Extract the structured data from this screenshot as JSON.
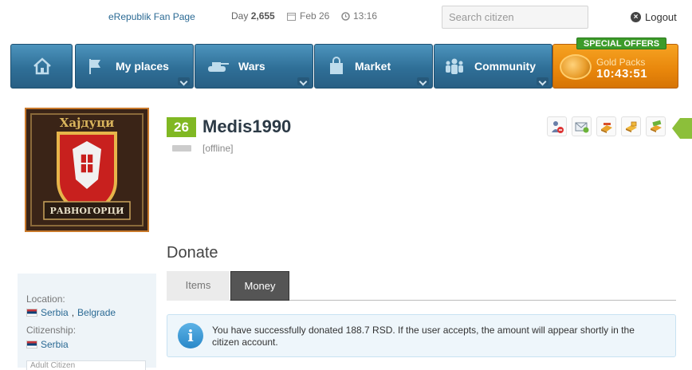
{
  "topbar": {
    "fan_page": "eRepublik Fan Page",
    "day_prefix": "Day",
    "day_number": "2,655",
    "date": "Feb 26",
    "time": "13:16",
    "search_placeholder": "Search citizen",
    "logout": "Logout"
  },
  "nav": {
    "items": [
      {
        "label": "",
        "icon": "home-icon"
      },
      {
        "label": "My places",
        "icon": "flag-icon"
      },
      {
        "label": "Wars",
        "icon": "tank-icon"
      },
      {
        "label": "Market",
        "icon": "shopping-bag-icon"
      },
      {
        "label": "Community",
        "icon": "people-icon"
      }
    ],
    "gold": {
      "label": "Gold Packs",
      "countdown": "10:43:51",
      "badge": "SPECIAL OFFERS"
    }
  },
  "profile": {
    "avatar_text_top": "Хајдуци",
    "avatar_text_bottom": "РАВНОГОРЦИ",
    "level": "26",
    "name": "Medis1990",
    "status": "[offline]"
  },
  "sidebar": {
    "location_label": "Location:",
    "location_country": "Serbia",
    "location_city": "Belgrade",
    "citizenship_label": "Citizenship:",
    "citizenship_country": "Serbia",
    "card_text": "Adult Citizen"
  },
  "donate": {
    "title": "Donate",
    "tabs": [
      {
        "label": "Items"
      },
      {
        "label": "Money"
      }
    ],
    "message": "You have successfully donated 188.7 RSD. If the user accepts, the amount will appear shortly in the citizen account."
  },
  "colors": {
    "nav_blue": "#2f6f97",
    "gold": "#e8860b",
    "level_green": "#80b823",
    "special_green": "#3c9b2a"
  }
}
